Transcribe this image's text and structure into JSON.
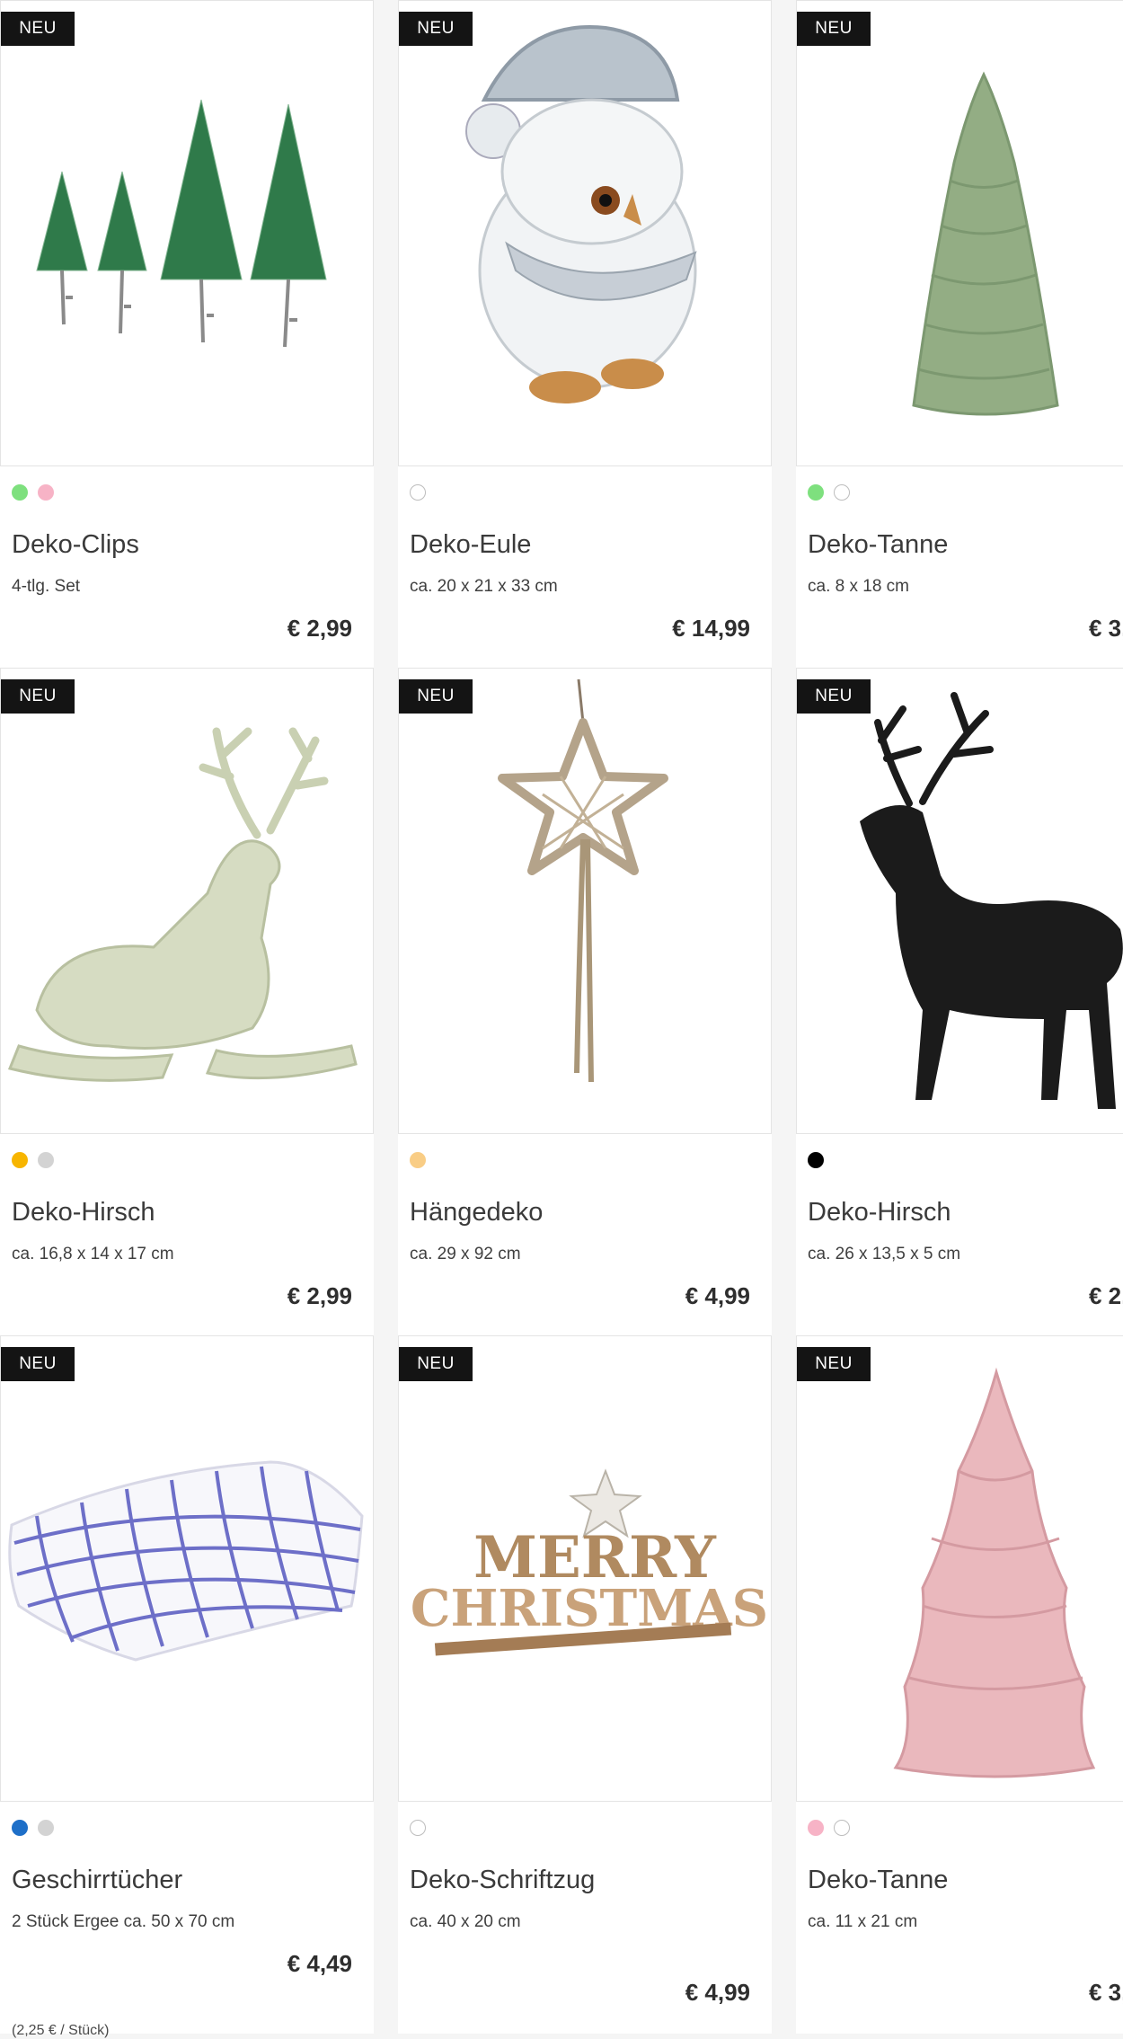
{
  "products": [
    {
      "badge": "NEU",
      "name": "Deko-Clips",
      "sub": "4-tlg. Set",
      "price": "€ 2,99",
      "swatches": [
        "#7ee07e",
        "#f7b3c6"
      ]
    },
    {
      "badge": "NEU",
      "name": "Deko-Eule",
      "sub": "ca. 20 x 21 x 33 cm",
      "price": "€ 14,99",
      "swatches": [
        "#ffffff"
      ]
    },
    {
      "badge": "NEU",
      "name": "Deko-Tanne",
      "sub": "ca. 8 x 18 cm",
      "price": "€ 3,",
      "swatches": [
        "#7ee07e",
        "#ffffff"
      ]
    },
    {
      "badge": "NEU",
      "name": "Deko-Hirsch",
      "sub": "ca. 16,8 x 14 x 17 cm",
      "price": "€ 2,99",
      "swatches": [
        "#f7b500",
        "#d3d3d3"
      ]
    },
    {
      "badge": "NEU",
      "name": "Hängedeko",
      "sub": "ca. 29 x 92 cm",
      "price": "€ 4,99",
      "swatches": [
        "#f9cd85"
      ]
    },
    {
      "badge": "NEU",
      "name": "Deko-Hirsch",
      "sub": "ca. 26 x 13,5 x 5 cm",
      "price": "€ 2,",
      "swatches": [
        "#000000"
      ]
    },
    {
      "badge": "NEU",
      "name": "Geschirrtücher",
      "sub": "2 Stück Ergee ca. 50 x 70 cm",
      "price": "€ 4,49",
      "unit": "(2,25 € / Stück)",
      "swatches": [
        "#1e6fc8",
        "#d3d3d3"
      ]
    },
    {
      "badge": "NEU",
      "name": "Deko-Schriftzug",
      "sub": "ca. 40 x 20 cm",
      "price": "€ 4,99",
      "swatches": [
        "#ffffff"
      ]
    },
    {
      "badge": "NEU",
      "name": "Deko-Tanne",
      "sub": "ca. 11 x 21 cm",
      "price": "€ 3,",
      "swatches": [
        "#f7b3c6",
        "#ffffff"
      ]
    }
  ],
  "images": [
    "bottlebrush-trees-icon",
    "owl-figurine-icon",
    "ceramic-tree-green-icon",
    "reclining-deer-glitter-icon",
    "macrame-star-icon",
    "black-deer-icon",
    "checked-towels-icon",
    "merry-christmas-sign-icon",
    "ceramic-tree-pink-icon"
  ],
  "art_text": {
    "sign_line1": "MERRY",
    "sign_line2": "CHRISTMAS"
  }
}
